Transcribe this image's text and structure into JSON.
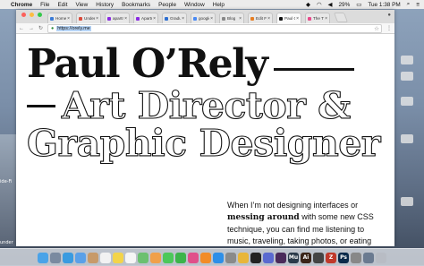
{
  "menubar": {
    "apple": "",
    "items": [
      "Chrome",
      "File",
      "Edit",
      "View",
      "History",
      "Bookmarks",
      "People",
      "Window",
      "Help"
    ],
    "battery": "29%",
    "clock": "Tue 1:38 PM"
  },
  "browser": {
    "tabs": [
      {
        "label": "Home",
        "color": "#3b7bd6"
      },
      {
        "label": "Under",
        "color": "#d94b3b"
      },
      {
        "label": "apartm",
        "color": "#8a2be2"
      },
      {
        "label": "Apartm",
        "color": "#8a2be2"
      },
      {
        "label": "Gradua",
        "color": "#2e6fd0"
      },
      {
        "label": "google",
        "color": "#4a8af4"
      },
      {
        "label": "Blog",
        "color": "#888888"
      },
      {
        "label": "Edit Fi",
        "color": "#e67e22"
      },
      {
        "label": "Paul O",
        "color": "#111111",
        "active": true
      },
      {
        "label": "The T",
        "color": "#e84a8a"
      }
    ],
    "url": "https://orely.me"
  },
  "page": {
    "name": "Paul O’Rely",
    "title_line1": "Art Director &",
    "title_line2": "Graphic Designer",
    "bio_pre": "When I’m not designing interfaces or",
    "bio_bold": "messing around",
    "bio_post": "with some new CSS technique, you can find me listening to music, traveling, taking photos, or eating"
  },
  "desktop": {
    "labels": [
      "ide-Fi",
      "under"
    ]
  },
  "dock": {
    "icons": [
      {
        "name": "finder-icon",
        "color": "#4aa3e8",
        "glyph": ""
      },
      {
        "name": "launchpad-icon",
        "color": "#7a8aa0",
        "glyph": ""
      },
      {
        "name": "safari-icon",
        "color": "#3a9be0",
        "glyph": ""
      },
      {
        "name": "mail-icon",
        "color": "#5aa0e8",
        "glyph": ""
      },
      {
        "name": "contacts-icon",
        "color": "#c79a6a",
        "glyph": ""
      },
      {
        "name": "calendar-icon",
        "color": "#f2f2f2",
        "glyph": ""
      },
      {
        "name": "notes-icon",
        "color": "#f3d44a",
        "glyph": ""
      },
      {
        "name": "reminders-icon",
        "color": "#f5f5f5",
        "glyph": ""
      },
      {
        "name": "maps-icon",
        "color": "#6cc070",
        "glyph": ""
      },
      {
        "name": "photos-icon",
        "color": "#f0a04a",
        "glyph": ""
      },
      {
        "name": "messages-icon",
        "color": "#4cc85a",
        "glyph": ""
      },
      {
        "name": "facetime-icon",
        "color": "#3cb44a",
        "glyph": ""
      },
      {
        "name": "itunes-icon",
        "color": "#e0508a",
        "glyph": ""
      },
      {
        "name": "ibooks-icon",
        "color": "#f28c28",
        "glyph": ""
      },
      {
        "name": "appstore-icon",
        "color": "#2e8fe8",
        "glyph": ""
      },
      {
        "name": "preferences-icon",
        "color": "#8a8a8a",
        "glyph": ""
      },
      {
        "name": "chrome-icon",
        "color": "#e8b63a",
        "glyph": ""
      },
      {
        "name": "terminal-icon",
        "color": "#222222",
        "glyph": ""
      },
      {
        "name": "app-icon",
        "color": "#5a6ad0",
        "glyph": ""
      },
      {
        "name": "slack-icon",
        "color": "#4a2a5a",
        "glyph": ""
      },
      {
        "name": "muse-icon",
        "color": "#2a3a4a",
        "glyph": "Mu"
      },
      {
        "name": "illustrator-icon",
        "color": "#3a2418",
        "glyph": "Ai"
      },
      {
        "name": "app2-icon",
        "color": "#444444",
        "glyph": ""
      },
      {
        "name": "filezilla-icon",
        "color": "#c0392b",
        "glyph": "Z"
      },
      {
        "name": "photoshop-icon",
        "color": "#0a2a4a",
        "glyph": "Ps"
      },
      {
        "name": "app3-icon",
        "color": "#888888",
        "glyph": ""
      },
      {
        "name": "downloads-icon",
        "color": "#6a7a90",
        "glyph": ""
      },
      {
        "name": "trash-icon",
        "color": "#b8bcc4",
        "glyph": ""
      }
    ]
  }
}
